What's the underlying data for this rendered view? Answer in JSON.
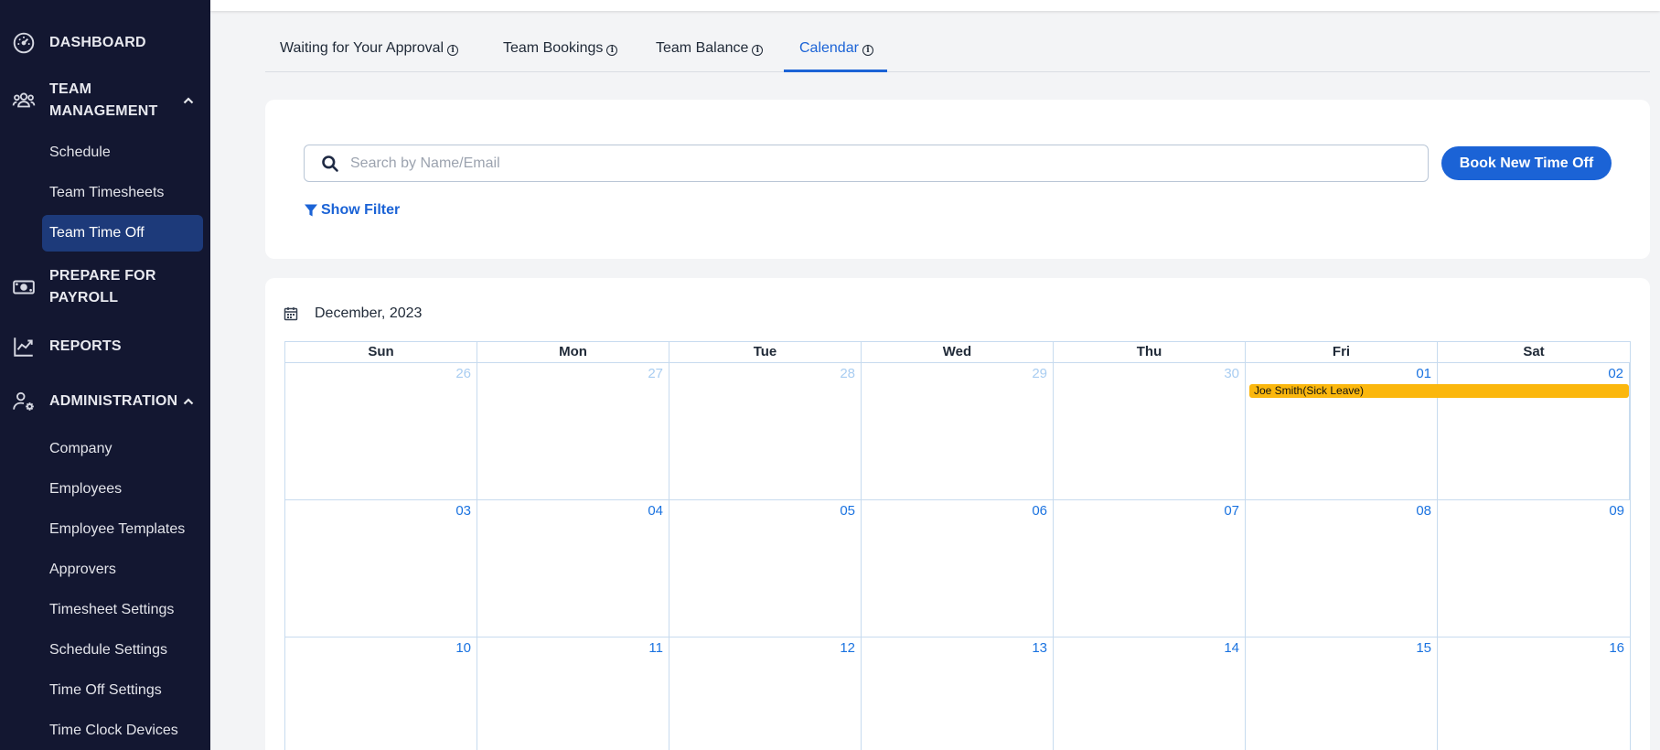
{
  "sidebar": {
    "dashboard": "DASHBOARD",
    "team_management": "TEAM MANAGEMENT",
    "team_items": [
      "Schedule",
      "Team Timesheets",
      "Team Time Off"
    ],
    "prepare_payroll": "PREPARE FOR PAYROLL",
    "reports": "REPORTS",
    "administration": "ADMINISTRATION",
    "admin_items": [
      "Company",
      "Employees",
      "Employee Templates",
      "Approvers",
      "Timesheet Settings",
      "Schedule Settings",
      "Time Off Settings",
      "Time Clock Devices"
    ],
    "active_item": "Team Time Off"
  },
  "tabs": [
    {
      "label": "Waiting for Your Approval",
      "info": "i"
    },
    {
      "label": "Team Bookings",
      "info": "i"
    },
    {
      "label": "Team Balance",
      "info": "i"
    },
    {
      "label": "Calendar",
      "info": "i"
    }
  ],
  "active_tab": "Calendar",
  "search": {
    "placeholder": "Search by Name/Email",
    "value": "",
    "book_button": "Book New Time Off",
    "filter_link": "Show Filter"
  },
  "calendar": {
    "month_label": "December, 2023",
    "weekdays": [
      "Sun",
      "Mon",
      "Tue",
      "Wed",
      "Thu",
      "Fri",
      "Sat"
    ],
    "weeks": [
      [
        "26",
        "27",
        "28",
        "29",
        "30",
        "01",
        "02"
      ],
      [
        "03",
        "04",
        "05",
        "06",
        "07",
        "08",
        "09"
      ],
      [
        "10",
        "11",
        "12",
        "13",
        "14",
        "15",
        "16"
      ]
    ],
    "out_of_month": [
      "26",
      "27",
      "28",
      "29",
      "30"
    ],
    "events": [
      {
        "label": "Joe Smith(Sick Leave)",
        "start": "01",
        "end": "02",
        "color": "#fbb70d"
      }
    ]
  },
  "colors": {
    "sidebar_bg": "#131731",
    "accent": "#1b63d6",
    "active_item_bg": "#1d3a7a",
    "event": "#fbb70d"
  }
}
